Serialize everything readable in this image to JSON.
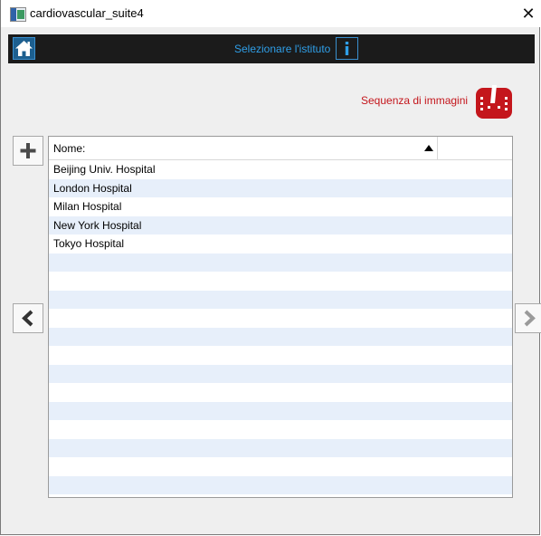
{
  "window": {
    "title": "cardiovascular_suite4"
  },
  "header": {
    "title": "Selezionare l'istituto"
  },
  "sequence": {
    "label": "Sequenza di immagini"
  },
  "table": {
    "column_name": "Nome:",
    "rows": [
      "Beijing Univ. Hospital",
      "London Hospital",
      "Milan Hospital",
      "New York Hospital",
      "Tokyo Hospital",
      "",
      "",
      "",
      "",
      "",
      "",
      "",
      "",
      "",
      "",
      "",
      "",
      "",
      ""
    ]
  },
  "icons": {
    "window": "app-icon",
    "close": "close-icon",
    "home": "home-icon",
    "info": "info-icon",
    "sequence": "image-sequence-icon",
    "add": "plus-icon",
    "prev": "chevron-left-icon",
    "next": "chevron-right-icon",
    "sort": "sort-ascending-icon"
  },
  "colors": {
    "header_bg": "#1b1b1b",
    "header_text": "#2f9fe8",
    "accent_red": "#c4161c",
    "row_alt": "#e7effa"
  }
}
